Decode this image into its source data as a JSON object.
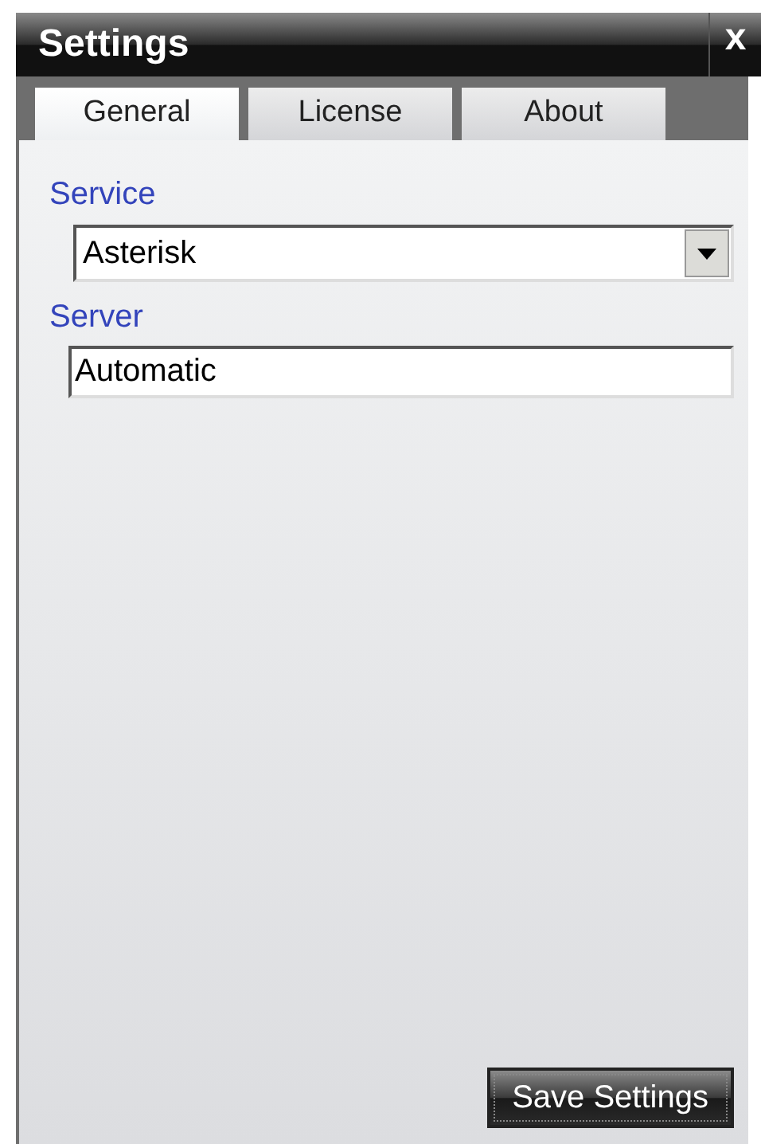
{
  "window": {
    "title": "Settings",
    "close": "x"
  },
  "tabs": [
    {
      "label": "General",
      "selected": true
    },
    {
      "label": "License",
      "selected": false
    },
    {
      "label": "About",
      "selected": false
    }
  ],
  "service": {
    "label": "Service",
    "value": "Asterisk"
  },
  "server": {
    "label": "Server",
    "value": "Automatic"
  },
  "save_button": "Save Settings"
}
